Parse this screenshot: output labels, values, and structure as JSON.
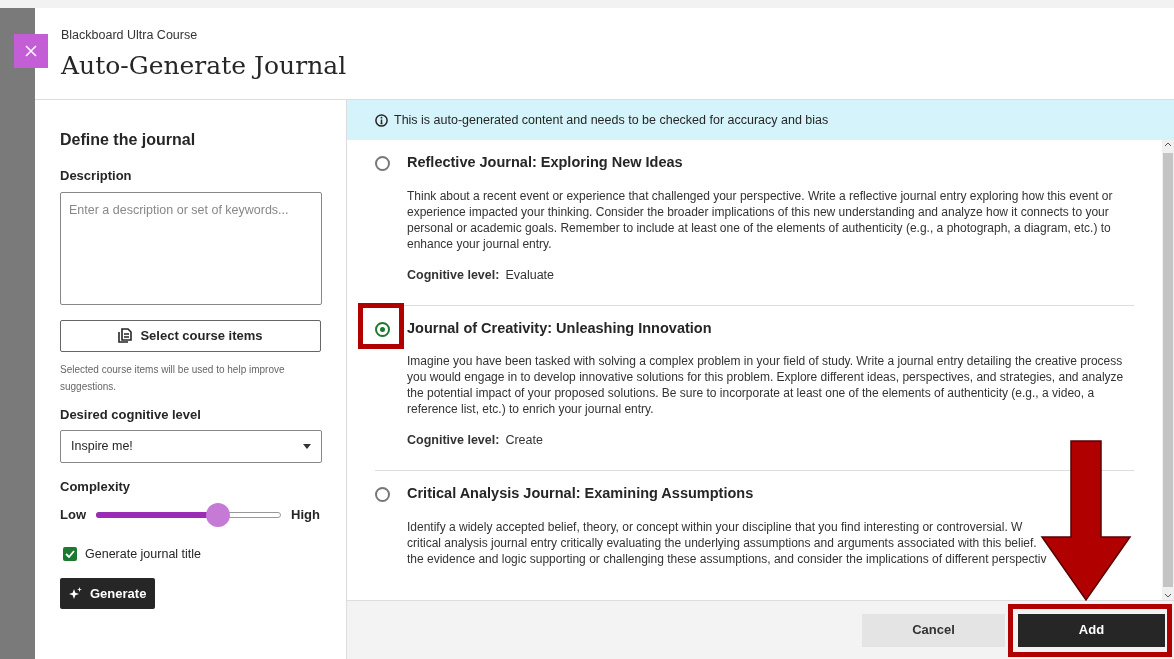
{
  "header": {
    "course": "Blackboard Ultra Course",
    "title": "Auto-Generate Journal"
  },
  "define": {
    "heading": "Define the journal",
    "description_label": "Description",
    "description": {
      "placeholder": "Enter a description or set of keywords..."
    },
    "select_button": "Select course items",
    "hint": "Selected course items will be used to help improve suggestions.",
    "level_label": "Desired cognitive level",
    "level_value": "Inspire me!",
    "complexity_label": "Complexity",
    "low": "Low",
    "high": "High",
    "complexity": {
      "level": 0.66
    },
    "generate_title": {
      "label": "Generate journal title",
      "checked": true
    },
    "generate_button": "Generate"
  },
  "notice": "This is auto-generated content and needs to be checked for accuracy and bias",
  "suggestions": [
    {
      "title": "Reflective Journal: Exploring New Ideas",
      "selected": false,
      "description": "Think about a recent event or experience that challenged your perspective. Write a reflective journal entry exploring how this event or experience impacted your thinking. Consider the broader implications of this new understanding and analyze how it connects to your personal or academic goals. Remember to include at least one of the elements of authenticity (e.g., a photograph, a diagram, etc.) to enhance your journal entry.",
      "level_label": "Cognitive level:",
      "level": "Evaluate",
      "highlighted": false
    },
    {
      "title": "Journal of Creativity: Unleashing Innovation",
      "selected": true,
      "description": "Imagine you have been tasked with solving a complex problem in your field of study. Write a journal entry detailing the creative process you would engage in to develop innovative solutions for this problem. Explore different ideas, perspectives, and strategies, and analyze the potential impact of your proposed solutions. Be sure to incorporate at least one of the elements of authenticity (e.g., a video, a reference list, etc.) to enrich your journal entry.",
      "level_label": "Cognitive level:",
      "level": "Create",
      "highlighted": true
    },
    {
      "title": "Critical Analysis Journal: Examining Assumptions",
      "selected": false,
      "description_lines": [
        "Identify a widely accepted belief, theory, or concept within your discipline that you find interesting or controversial. W",
        "critical analysis journal entry critically evaluating the underlying assumptions and arguments associated with this belief.",
        "the evidence and logic supporting or challenging these assumptions, and consider the implications of different perspectiv"
      ],
      "highlighted": false
    }
  ],
  "footer": {
    "cancel": "Cancel",
    "add": "Add",
    "add_highlighted": true
  }
}
